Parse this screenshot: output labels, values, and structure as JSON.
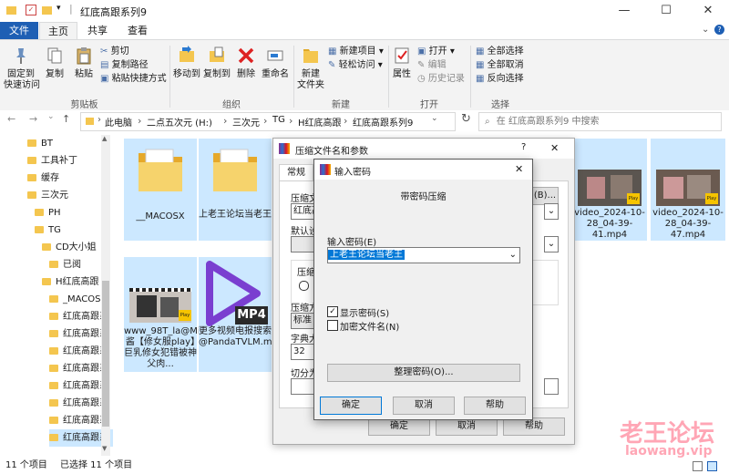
{
  "window": {
    "title": "红底高跟系列9",
    "controls": [
      "—",
      "☐",
      "✕"
    ]
  },
  "ribbon_tabs": [
    "文件",
    "主页",
    "共享",
    "查看"
  ],
  "ribbon": {
    "clipboard": {
      "pin": "固定到\n快速访问",
      "copy": "复制",
      "paste": "粘贴",
      "cut": "剪切",
      "copy_path": "复制路径",
      "paste_shortcut": "粘贴快捷方式",
      "group": "剪贴板"
    },
    "organize": {
      "move_to": "移动到",
      "copy_to": "复制到",
      "delete": "删除",
      "rename": "重命名",
      "group": "组织"
    },
    "new": {
      "new_folder": "新建\n文件夹",
      "new_item": "新建项目 ▾",
      "easy_access": "轻松访问 ▾",
      "group": "新建"
    },
    "open": {
      "properties": "属性",
      "open": "打开 ▾",
      "edit": "编辑",
      "history": "历史记录",
      "group": "打开"
    },
    "select": {
      "select_all": "全部选择",
      "select_none": "全部取消",
      "invert": "反向选择",
      "group": "选择"
    }
  },
  "address": {
    "crumbs": [
      "此电脑",
      "二点五次元 (H:)",
      "三次元",
      "TG",
      "H红底高跟",
      "红底高跟系列9"
    ],
    "search_placeholder": "在 红底高跟系列9 中搜索"
  },
  "nav": {
    "items": [
      {
        "label": "BT",
        "indent": 0
      },
      {
        "label": "工具补丁",
        "indent": 0
      },
      {
        "label": "缓存",
        "indent": 0
      },
      {
        "label": "三次元",
        "indent": 0
      },
      {
        "label": "PH",
        "indent": 1
      },
      {
        "label": "TG",
        "indent": 1
      },
      {
        "label": "CD大小姐",
        "indent": 2
      },
      {
        "label": "已阅",
        "indent": 3
      },
      {
        "label": "H红底高跟",
        "indent": 2
      },
      {
        "label": "_MACOS",
        "indent": 3
      },
      {
        "label": "红底高跟系",
        "indent": 3
      },
      {
        "label": "红底高跟系",
        "indent": 3
      },
      {
        "label": "红底高跟系",
        "indent": 3
      },
      {
        "label": "红底高跟系",
        "indent": 3
      },
      {
        "label": "红底高跟系",
        "indent": 3
      },
      {
        "label": "红底高跟系",
        "indent": 3
      },
      {
        "label": "红底高跟系",
        "indent": 3
      },
      {
        "label": "红底高跟系",
        "indent": 3
      }
    ]
  },
  "files": {
    "macosx": "__MACOSX",
    "folder2": "上老王论坛当老王",
    "video1": "video_2024-10-28_04-39-41.mp4",
    "video2": "video_2024-10-28_04-39-47.mp4",
    "www": "www_98T_la@Misa酱【修女服play】巨乳修女犯错被神父肉...",
    "mp4": "更多视频电报搜索@PandaTVLM.mp4",
    "mp4_badge": "MP4",
    "play_badge": "Play"
  },
  "status": {
    "count": "11 个项目",
    "selected": "已选择 11 个项目"
  },
  "dialog_compress": {
    "title": "压缩文件名和参数",
    "help": "?",
    "close": "✕",
    "tab": "常规",
    "label_archive": "压缩文",
    "archive_value": "红底高",
    "browse": "(B)...",
    "label_default": "默认设",
    "label_format": "压缩",
    "label_method": "压缩方",
    "method_value": "标准",
    "label_dict": "字典大",
    "dict_value": "32",
    "label_split": "切分为",
    "ok": "确定",
    "cancel": "取消",
    "help_btn": "帮助"
  },
  "dialog_password": {
    "title": "输入密码",
    "close": "✕",
    "heading": "带密码压缩",
    "password_label": "输入密码(E)",
    "password_value": "上老王论坛当老王",
    "show_password": "显示密码(S)",
    "encrypt_names": "加密文件名(N)",
    "organize": "整理密码(O)...",
    "ok": "确定",
    "cancel": "取消",
    "help": "帮助"
  },
  "watermark": {
    "text": "老王论坛",
    "url": "laowang.vip"
  }
}
